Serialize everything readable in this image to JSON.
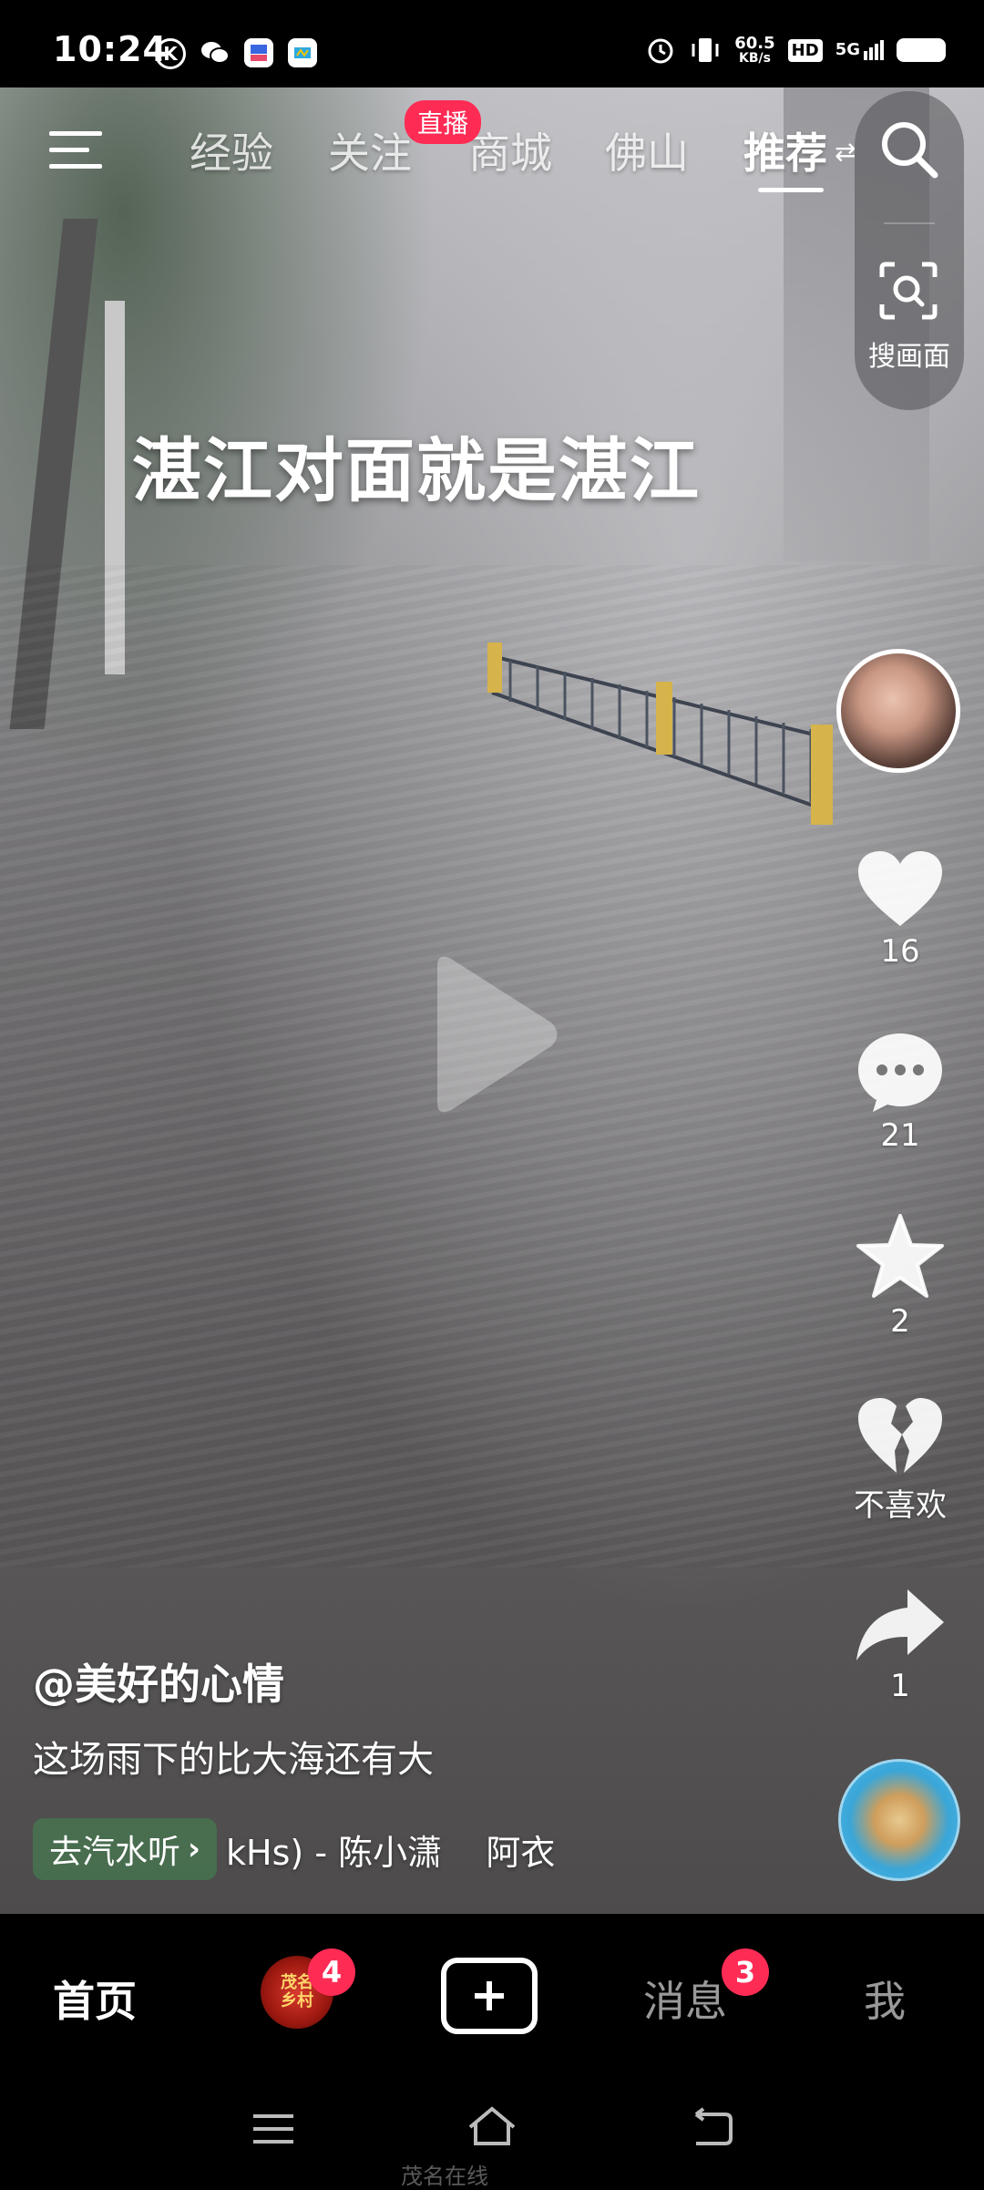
{
  "status_bar": {
    "time": "10:24",
    "left_icons": [
      "k-icon",
      "wechat-icon",
      "app-icon",
      "app-icon-2"
    ],
    "network_speed_value": "60.5",
    "network_speed_unit": "KB/s",
    "hd_label": "HD",
    "network_type": "5G"
  },
  "top_nav": {
    "tabs": [
      {
        "label": "经验"
      },
      {
        "label": "关注"
      },
      {
        "label": "商城"
      },
      {
        "label": "佛山"
      },
      {
        "label": "推荐"
      }
    ],
    "live_badge": "直播",
    "search_screen_label": "搜画面"
  },
  "video": {
    "overlay_text": "湛江对面就是湛江"
  },
  "actions": {
    "like_count": "16",
    "comment_count": "21",
    "favorite_count": "2",
    "dislike_label": "不喜欢",
    "share_count": "1"
  },
  "post": {
    "author": "@美好的心情",
    "caption": "这场雨下的比大海还有大",
    "qishui_label": "去汽水听",
    "music_text": "kHs) - 陈小潇    阿衣"
  },
  "bottom_tabs": {
    "home": "首页",
    "thumb_text": "茂名\n乡村",
    "thumb_badge": "4",
    "messages": "消息",
    "messages_badge": "3",
    "me": "我"
  },
  "watermark": "茂名在线"
}
